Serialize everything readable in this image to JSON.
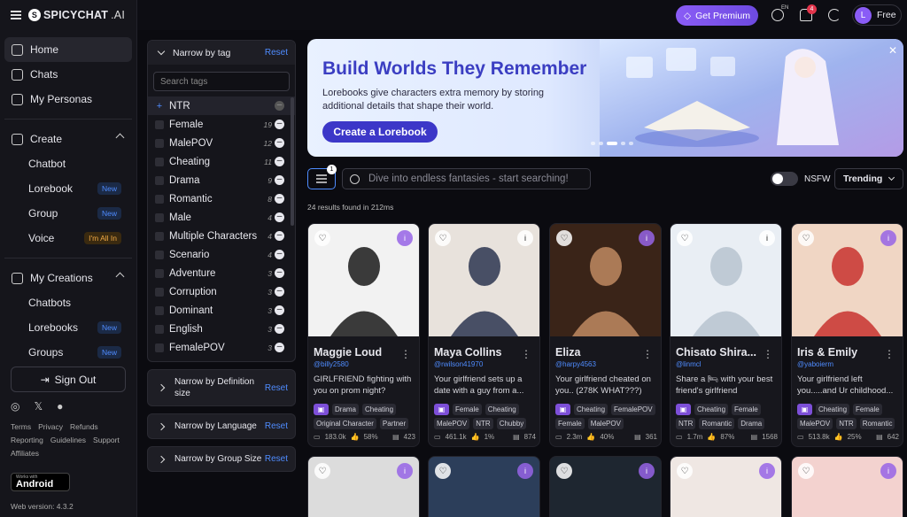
{
  "brand": {
    "name": "SPICYCHAT",
    "suffix": ".AI"
  },
  "nav": {
    "home": "Home",
    "chats": "Chats",
    "personas": "My Personas",
    "create": "Create",
    "chatbot": "Chatbot",
    "lorebook": "Lorebook",
    "group": "Group",
    "voice": "Voice",
    "new_badge": "New",
    "allin_badge": "I'm All In",
    "my_creations": "My Creations",
    "chatbots": "Chatbots",
    "lorebooks": "Lorebooks",
    "groups": "Groups",
    "sign_out": "Sign Out",
    "links": [
      "Terms",
      "Privacy",
      "Refunds",
      "Reporting",
      "Guidelines",
      "Support",
      "Affiliates"
    ],
    "android_top": "Works with",
    "android": "Android",
    "version": "Web version: 4.3.2"
  },
  "topbar": {
    "premium": "Get Premium",
    "lang": "EN",
    "notifications": "4",
    "user_initial": "L",
    "plan": "Free"
  },
  "tags": {
    "title": "Narrow by tag",
    "reset": "Reset",
    "search_placeholder": "Search tags",
    "selected": "NTR",
    "items": [
      {
        "label": "Female",
        "count": "19"
      },
      {
        "label": "MalePOV",
        "count": "12"
      },
      {
        "label": "Cheating",
        "count": "11"
      },
      {
        "label": "Drama",
        "count": "9"
      },
      {
        "label": "Romantic",
        "count": "8"
      },
      {
        "label": "Male",
        "count": "4"
      },
      {
        "label": "Multiple Characters",
        "count": "4"
      },
      {
        "label": "Scenario",
        "count": "4"
      },
      {
        "label": "Adventure",
        "count": "3"
      },
      {
        "label": "Corruption",
        "count": "3"
      },
      {
        "label": "Dominant",
        "count": "3"
      },
      {
        "label": "English",
        "count": "3"
      },
      {
        "label": "FemalePOV",
        "count": "3"
      }
    ]
  },
  "narrow": {
    "definition": "Narrow by Definition size",
    "language": "Narrow by Language",
    "group_size": "Narrow by Group Size",
    "reset": "Reset"
  },
  "banner": {
    "title": "Build Worlds They Remember",
    "subtitle": "Lorebooks give characters extra memory by storing additional details that shape their world.",
    "cta": "Create a Lorebook"
  },
  "search": {
    "placeholder": "Dive into endless fantasies - start searching!",
    "filter_count": "1",
    "nsfw": "NSFW",
    "sort": "Trending",
    "results": "24 results found in 212ms"
  },
  "cards": [
    {
      "name": "Maggie Loud",
      "handle": "@billy2580",
      "desc": "GIRLFRIEND fighting with you on prom night?",
      "tags": [
        "Drama",
        "Cheating",
        "Original Character",
        "Partner"
      ],
      "chats": "183.0k",
      "likes": "58%",
      "defs": "423"
    },
    {
      "name": "Maya Collins",
      "handle": "@rwilson41970",
      "desc": "Your girlfriend sets up a date with a guy from a...",
      "tags": [
        "Female",
        "Cheating",
        "MalePOV",
        "NTR",
        "Chubby"
      ],
      "chats": "461.1k",
      "likes": "1%",
      "defs": "874"
    },
    {
      "name": "Eliza",
      "handle": "@harpy4563",
      "desc": "Your girlfriend cheated on you.. (278K WHAT???)",
      "tags": [
        "Cheating",
        "FemalePOV",
        "Female",
        "MalePOV"
      ],
      "chats": "2.3m",
      "likes": "40%",
      "defs": "361"
    },
    {
      "name": "Chisato Shira...",
      "handle": "@linmcl",
      "desc": "Share a 🛏 with your best friend's girlfriend",
      "tags": [
        "Cheating",
        "Female",
        "NTR",
        "Romantic",
        "Drama"
      ],
      "chats": "1.7m",
      "likes": "87%",
      "defs": "1568"
    },
    {
      "name": "Iris & Emily",
      "handle": "@yaboierm",
      "desc": "Your girlfriend left you.....and Ur childhood...",
      "tags": [
        "Cheating",
        "Female",
        "MalePOV",
        "NTR",
        "Romantic"
      ],
      "chats": "513.8k",
      "likes": "25%",
      "defs": "642"
    }
  ]
}
